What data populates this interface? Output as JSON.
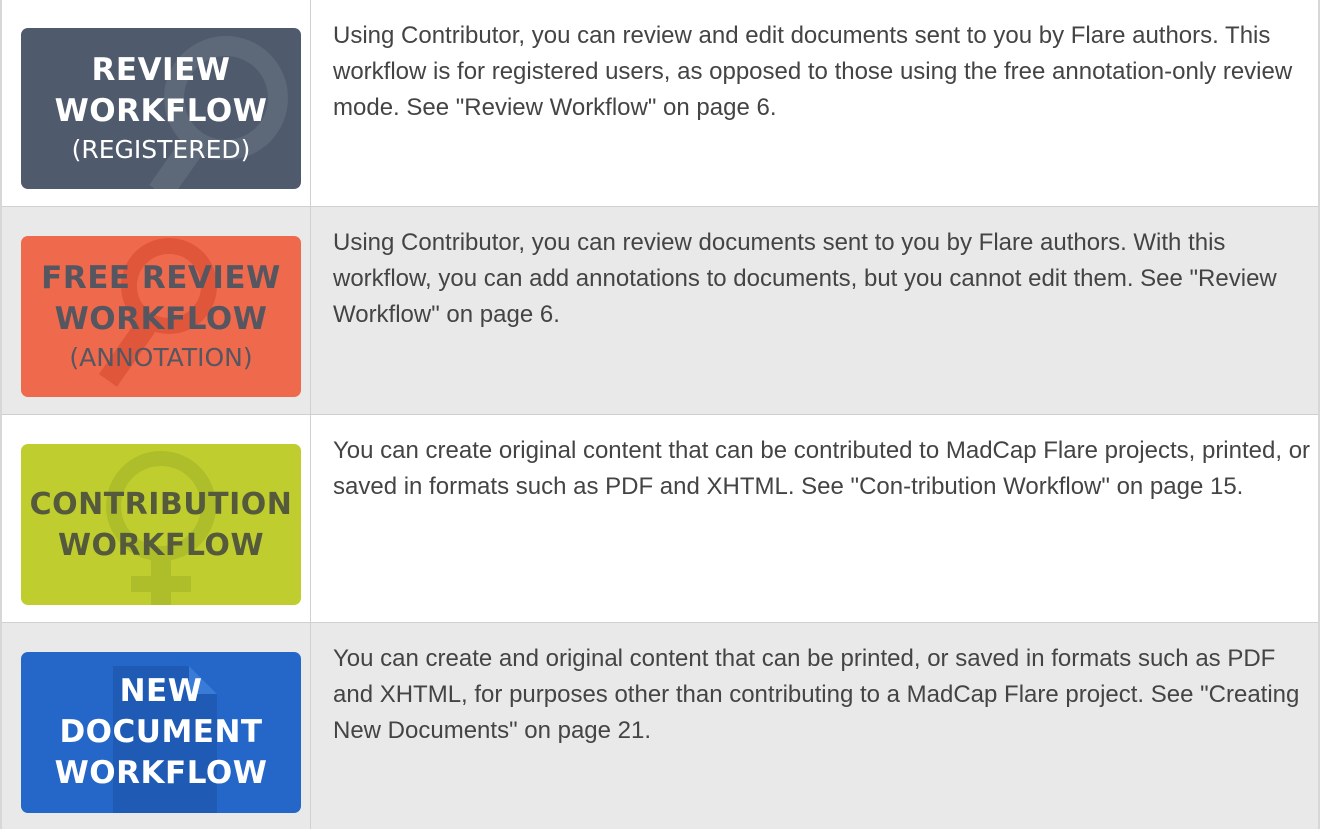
{
  "rows": [
    {
      "badge": {
        "lines": [
          "REVIEW",
          "WORKFLOW"
        ],
        "sub": "(REGISTERED)",
        "color": "#4f5b6d",
        "icon": "magnifier-icon"
      },
      "description": "Using Contributor, you can review and edit documents sent to you by Flare authors. This workflow is for registered users, as opposed to those using the free annotation-only review mode. See \"Review Workflow\" on page 6."
    },
    {
      "badge": {
        "lines": [
          "FREE REVIEW",
          "WORKFLOW"
        ],
        "sub": "(ANNOTATION)",
        "color": "#ef6a4c",
        "icon": "magnifier-icon"
      },
      "description": "Using Contributor, you can review documents sent to you by Flare authors. With this workflow, you can add annotations to documents, but you cannot edit them. See \"Review Workflow\" on page 6."
    },
    {
      "badge": {
        "lines": [
          "CONTRIBUTION",
          "WORKFLOW"
        ],
        "sub": "",
        "color": "#bfce2e",
        "icon": "female-symbol-icon"
      },
      "description": "You can create original content that can be contributed to MadCap Flare projects, printed, or saved in formats such as PDF and XHTML. See \"Con-tribution Workflow\" on page 15."
    },
    {
      "badge": {
        "lines": [
          "NEW",
          "DOCUMENT",
          "WORKFLOW"
        ],
        "sub": "",
        "color": "#2567c8",
        "icon": "document-icon"
      },
      "description": "You can create and original content that can be printed, or saved in formats such as PDF and XHTML, for purposes other than contributing to a MadCap Flare project. See \"Creating New Documents\" on page 21."
    }
  ]
}
